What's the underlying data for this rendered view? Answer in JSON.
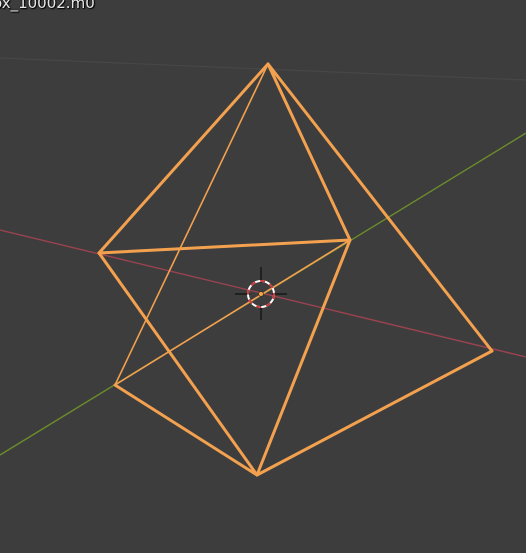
{
  "viewport": {
    "object_name": "ox_10002.m0",
    "background_color": "#3d3d3d",
    "grid_line_color": "#474747",
    "x_axis_color": "#9a4350",
    "y_axis_color": "#6b8c2a",
    "selection_color": "#f3a14f",
    "cursor_ring_color_a": "#c93a3a",
    "cursor_ring_color_b": "#ffffff",
    "origin_dot_color": "#f5a33f"
  }
}
